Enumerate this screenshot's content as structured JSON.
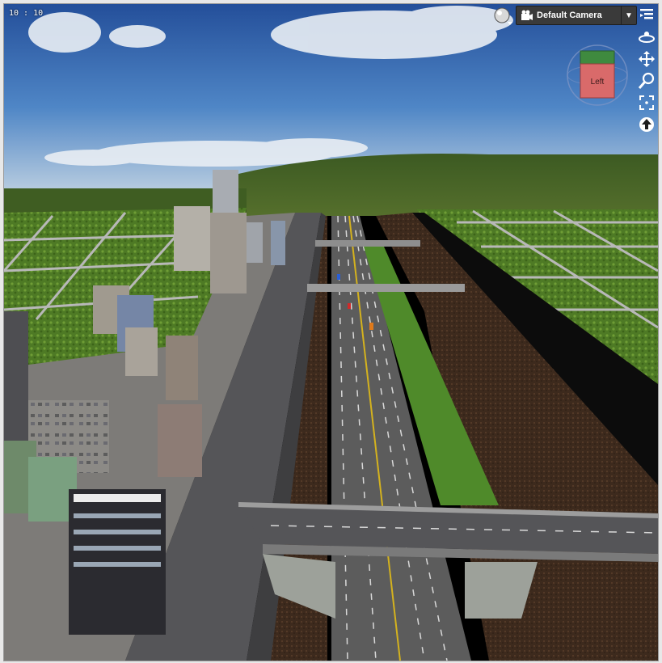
{
  "viewport": {
    "fps_text": "10 : 10",
    "camera": {
      "label": "Default Camera",
      "dropdown_arrow": "▼"
    },
    "view_cube": {
      "face_label": "Left"
    },
    "tools": [
      {
        "name": "orbit-icon"
      },
      {
        "name": "pan-icon"
      },
      {
        "name": "zoom-icon"
      },
      {
        "name": "frame-icon"
      },
      {
        "name": "dolly-icon"
      }
    ],
    "menu_icon": "viewport-menu-icon",
    "lighting_icon": "draw-style-sphere-icon"
  },
  "colors": {
    "sky_top": "#2c5ea8",
    "grass": "#5f8f2e",
    "dirt": "#3e2a1c",
    "road": "#5a5a5a",
    "cube_face": "#d96a6a",
    "cube_top": "#3f8a3f"
  }
}
